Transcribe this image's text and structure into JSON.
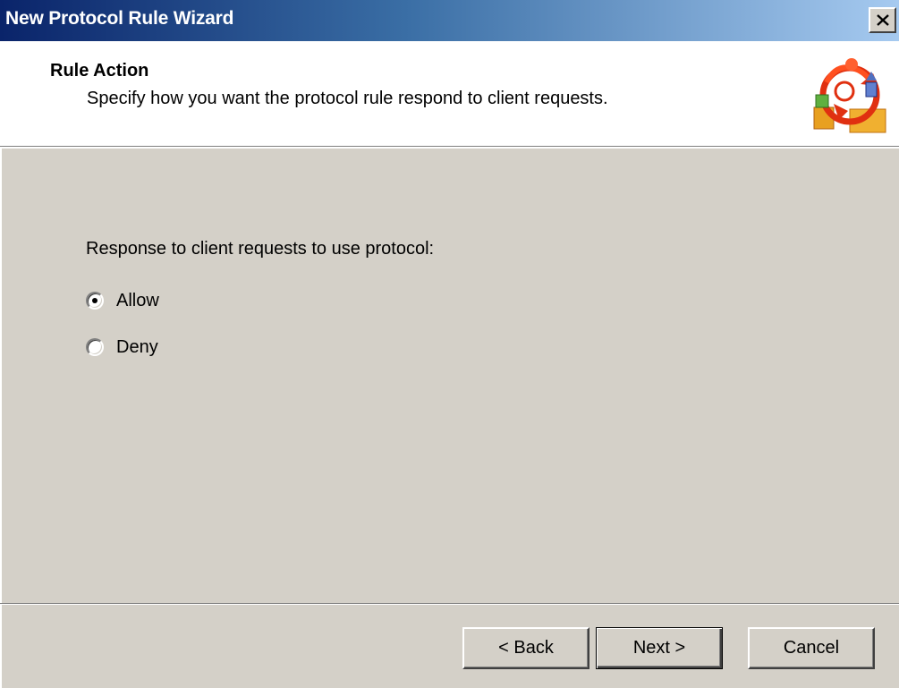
{
  "window": {
    "title": "New Protocol Rule Wizard",
    "close_icon": "close-icon"
  },
  "header": {
    "title": "Rule Action",
    "subtitle": "Specify how you want the protocol rule respond to client requests.",
    "icon": "protocol-rule-wizard-icon"
  },
  "form": {
    "prompt": "Response to client requests to use protocol:",
    "options": [
      {
        "label": "Allow",
        "selected": true
      },
      {
        "label": "Deny",
        "selected": false
      }
    ]
  },
  "buttons": {
    "back": "< Back",
    "next": "Next >",
    "cancel": "Cancel"
  }
}
